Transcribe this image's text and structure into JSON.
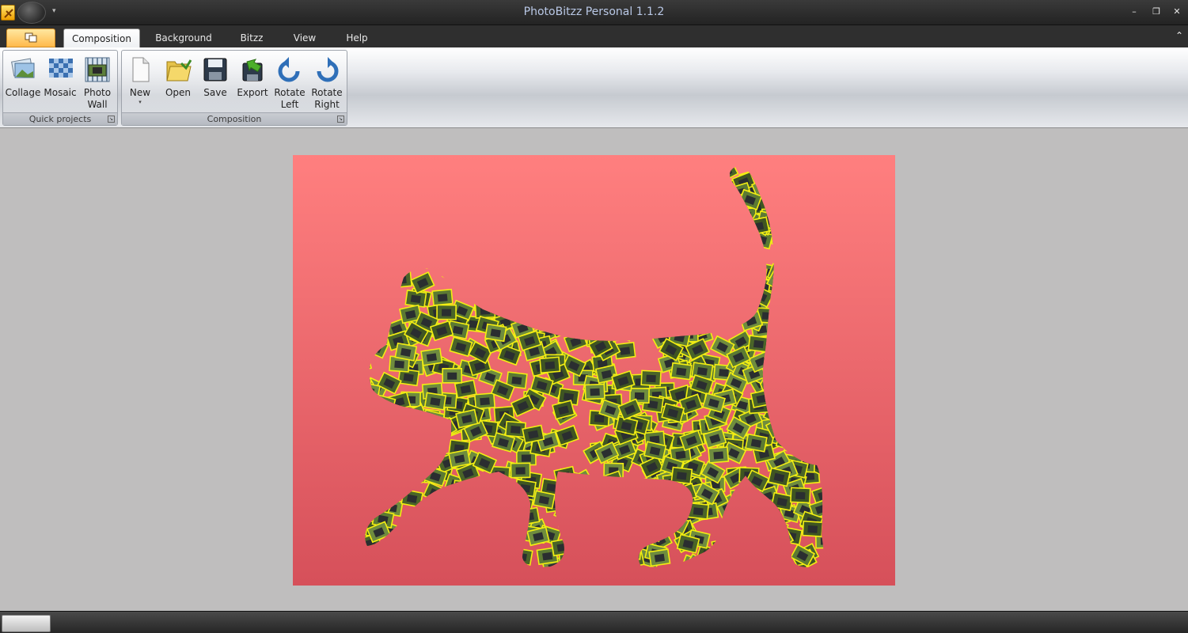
{
  "window": {
    "title": "PhotoBitzz Personal 1.1.2",
    "controls": {
      "minimize": "–",
      "restore": "❐",
      "close": "✕"
    }
  },
  "tabs": [
    {
      "label": "Composition",
      "active": true
    },
    {
      "label": "Background",
      "active": false
    },
    {
      "label": "Bitzz",
      "active": false
    },
    {
      "label": "View",
      "active": false
    },
    {
      "label": "Help",
      "active": false
    }
  ],
  "ribbon": {
    "groups": [
      {
        "label": "Quick projects",
        "buttons": [
          {
            "label": "Collage",
            "icon": "collage-icon"
          },
          {
            "label": "Mosaic",
            "icon": "mosaic-icon"
          },
          {
            "label_1": "Photo",
            "label_2": "Wall",
            "icon": "photo-wall-icon"
          }
        ]
      },
      {
        "label": "Composition",
        "buttons": [
          {
            "label": "New",
            "icon": "new-document-icon",
            "dropdown": "▾"
          },
          {
            "label": "Open",
            "icon": "open-folder-icon"
          },
          {
            "label": "Save",
            "icon": "save-floppy-icon"
          },
          {
            "label": "Export",
            "icon": "export-icon"
          },
          {
            "label_1": "Rotate",
            "label_2": "Left",
            "icon": "rotate-left-icon"
          },
          {
            "label_1": "Rotate",
            "label_2": "Right",
            "icon": "rotate-right-icon"
          }
        ]
      }
    ]
  },
  "canvas": {
    "background_top": "#ff7f7f",
    "background_bottom": "#d6505a",
    "tile_border": "#f2ee12",
    "subject": "cat-silhouette photo collage"
  }
}
